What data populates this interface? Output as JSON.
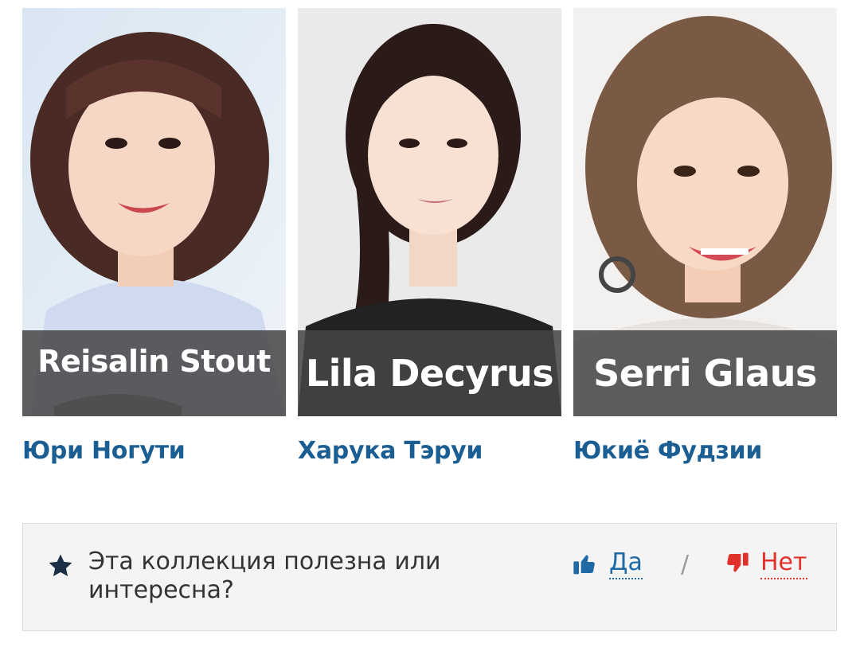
{
  "characters": [
    {
      "role": "Reisalin Stout",
      "actor": "Юри Ногути"
    },
    {
      "role": "Lila Decyrus",
      "actor": "Харука Тэруи"
    },
    {
      "role": "Serri Glaus",
      "actor": "Юкиё Фудзии"
    }
  ],
  "feedback": {
    "question": "Эта коллекция полезна или интересна?",
    "yes_label": "Да",
    "separator": "/",
    "no_label": "Нет",
    "icons": {
      "star": "star-icon",
      "yes": "thumbs-up-icon",
      "no": "thumbs-down-icon"
    },
    "colors": {
      "yes": "#1f6aa5",
      "no": "#e0322b"
    }
  },
  "colors": {
    "actor_link": "#1b5e93",
    "role_band": "#464646"
  }
}
